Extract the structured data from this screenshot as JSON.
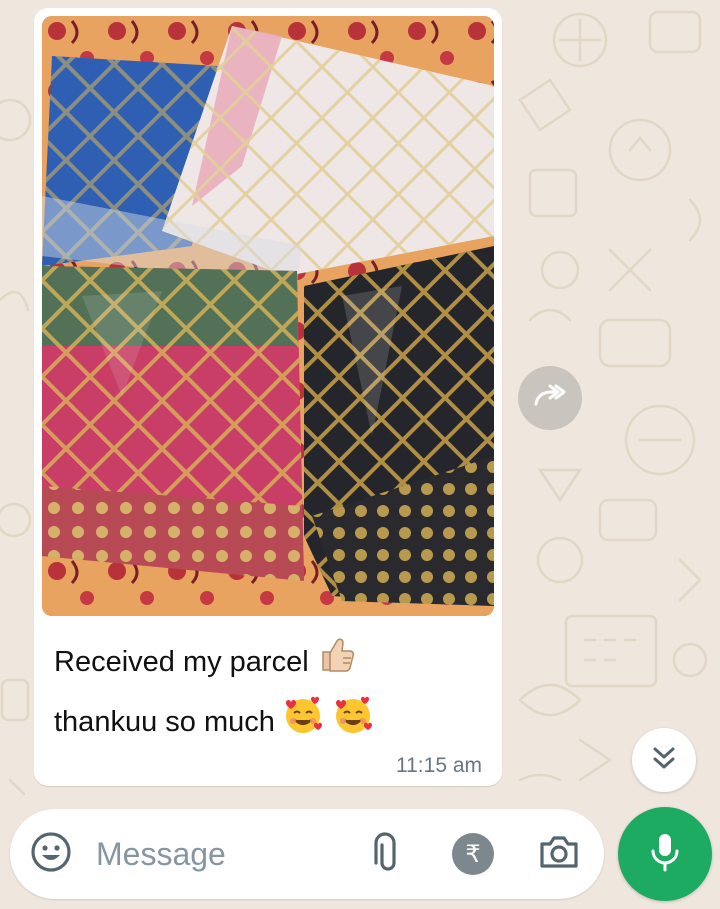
{
  "message": {
    "caption_line1": "Received my parcel",
    "caption_line2": "thankuu so much",
    "time": "11:15 am",
    "emoji_line1": "thumbs-up-emoji",
    "emoji_line2": [
      "smiling-face-with-hearts-emoji",
      "smiling-face-with-hearts-emoji"
    ]
  },
  "input": {
    "placeholder": "Message"
  },
  "payment": {
    "symbol": "₹"
  },
  "colors": {
    "wallpaper": "#efe7dd",
    "bubble": "#ffffff",
    "timestamp": "#667781",
    "mic_button": "#1daa61",
    "placeholder": "#8696a0"
  },
  "icons": {
    "forward": "forward-icon",
    "scroll_down": "double-chevron-down-icon",
    "emoji": "emoji-icon",
    "attach": "paperclip-icon",
    "payment": "rupee-icon",
    "camera": "camera-icon",
    "mic": "microphone-icon"
  }
}
